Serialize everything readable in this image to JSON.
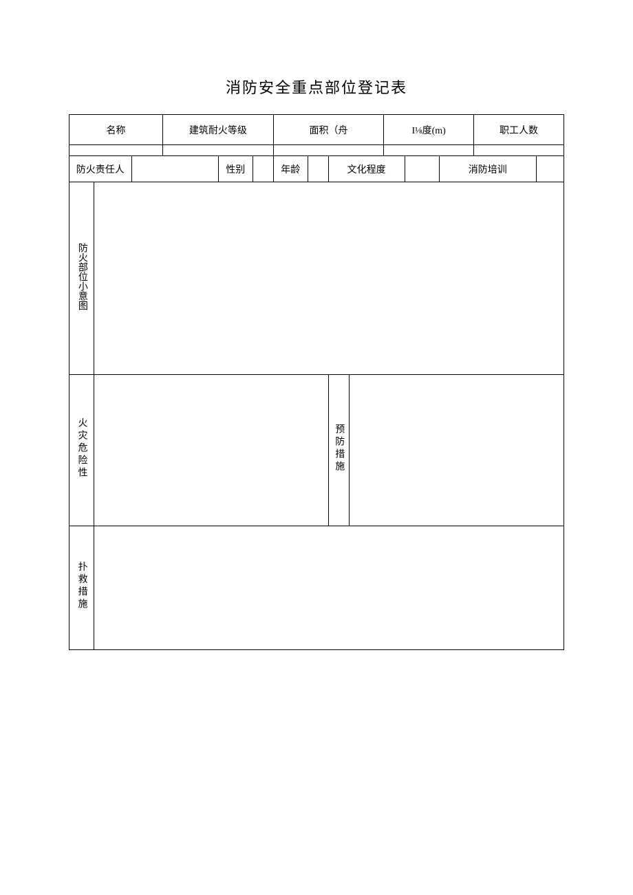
{
  "title": "消防安全重点部位登记表",
  "row1": {
    "name_label": "名称",
    "fire_resistance_label": "建筑耐火等级",
    "area_label": "面积（舟",
    "height_label": "I⅛度(m)",
    "staff_label": "职工人数"
  },
  "row3": {
    "responsible_label": "防火责任人",
    "gender_label": "性别",
    "age_label": "年龄",
    "education_label": "文化程度",
    "training_label": "消防培训"
  },
  "section1_label": "防火部位小意图",
  "section2a_label": "火灾危险性",
  "section2b_label": "预防措施",
  "section3_label": "扑救措施"
}
